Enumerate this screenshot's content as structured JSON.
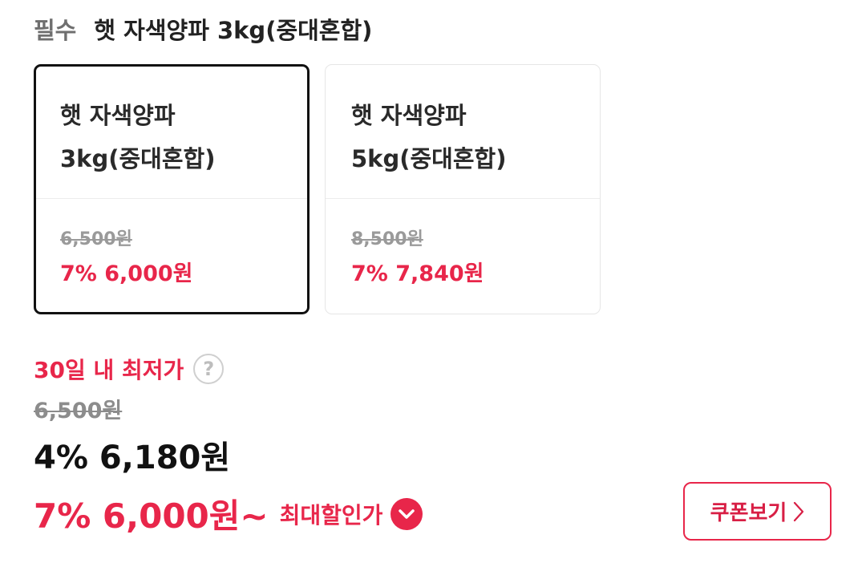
{
  "header": {
    "required_label": "필수",
    "selected_option": "햇 자색양파 3kg(중대혼합)"
  },
  "options": [
    {
      "name_line1": "햇 자색양파",
      "name_line2": "3kg(중대혼합)",
      "original_price": "6,500원",
      "sale_price": "7% 6,000원",
      "selected": true
    },
    {
      "name_line1": "햇 자색양파",
      "name_line2": "5kg(중대혼합)",
      "original_price": "8,500원",
      "sale_price": "7% 7,840원",
      "selected": false
    }
  ],
  "summary": {
    "lowest_label": "30일 내 최저가",
    "help_icon": "help-circle-icon",
    "original_price": "6,500원",
    "current_price": "4% 6,180원",
    "max_discount_price": "7% 6,000원~",
    "max_discount_label": "최대할인가",
    "max_discount_icon": "chevron-down-circle-icon",
    "coupon_button_label": "쿠폰보기",
    "coupon_arrow_icon": "chevron-right-icon"
  },
  "colors": {
    "accent": "#e8264a",
    "selected_border": "#111111",
    "muted_text": "#9a9a9a"
  }
}
